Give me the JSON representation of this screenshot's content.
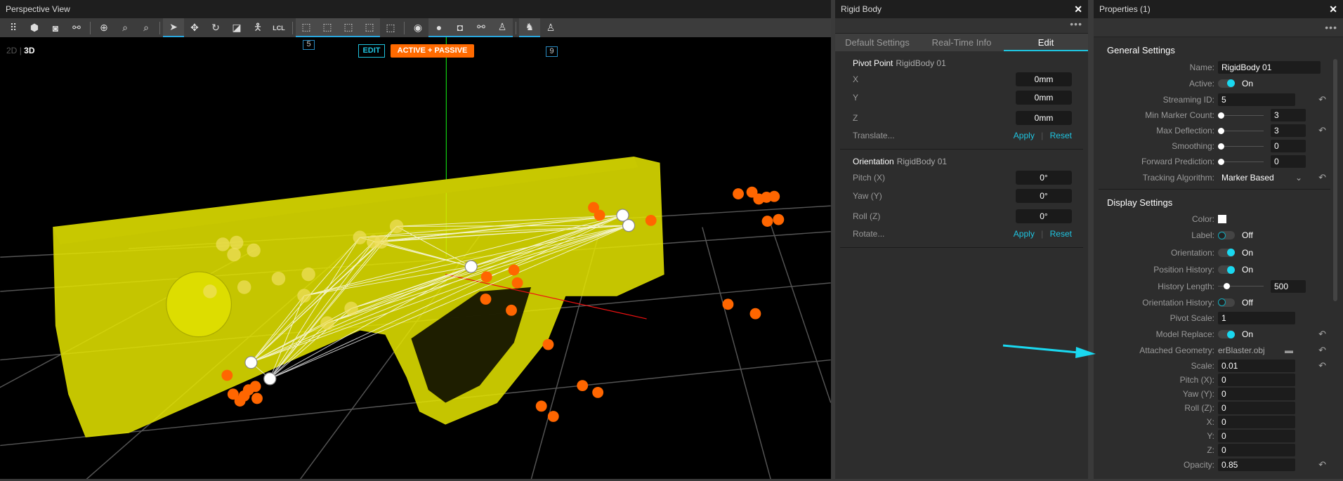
{
  "perspective": {
    "title": "Perspective View",
    "mode_2d": "2D",
    "mode_3d": "3D",
    "edit_badge": "EDIT",
    "mode_badge": "ACTIVE + PASSIVE",
    "marker_count_a": "5",
    "marker_count_b": "9",
    "toolbar_lcl": "LCL"
  },
  "rigid_body": {
    "title": "Rigid Body",
    "tabs": [
      "Default Settings",
      "Real-Time Info",
      "Edit"
    ],
    "pivot": {
      "heading": "Pivot Point",
      "name": "RigidBody 01",
      "rows": [
        {
          "label": "X",
          "value": "0mm"
        },
        {
          "label": "Y",
          "value": "0mm"
        },
        {
          "label": "Z",
          "value": "0mm"
        }
      ],
      "action": "Translate...",
      "apply": "Apply",
      "reset": "Reset"
    },
    "orientation": {
      "heading": "Orientation",
      "name": "RigidBody 01",
      "rows": [
        {
          "label": "Pitch (X)",
          "value": "0°"
        },
        {
          "label": "Yaw (Y)",
          "value": "0°"
        },
        {
          "label": "Roll (Z)",
          "value": "0°"
        }
      ],
      "action": "Rotate...",
      "apply": "Apply",
      "reset": "Reset"
    }
  },
  "properties": {
    "title": "Properties (1)",
    "general": {
      "heading": "General Settings",
      "name_label": "Name:",
      "name": "RigidBody 01",
      "active_label": "Active:",
      "active": "On",
      "streaming_label": "Streaming ID:",
      "streaming": "5",
      "min_label": "Min Marker Count:",
      "min": "3",
      "maxdef_label": "Max Deflection:",
      "maxdef": "3",
      "smooth_label": "Smoothing:",
      "smooth": "0",
      "fwd_label": "Forward Prediction:",
      "fwd": "0",
      "algo_label": "Tracking Algorithm:",
      "algo": "Marker Based"
    },
    "display": {
      "heading": "Display Settings",
      "color_label": "Color:",
      "color": "#ffffff",
      "label_label": "Label:",
      "label": "Off",
      "orient_label": "Orientation:",
      "orient": "On",
      "poshist_label": "Position History:",
      "poshist": "On",
      "histlen_label": "History Length:",
      "histlen": "500",
      "orhist_label": "Orientation History:",
      "orhist": "Off",
      "pivscale_label": "Pivot Scale:",
      "pivscale": "1",
      "model_label": "Model Replace:",
      "model": "On",
      "geom_label": "Attached Geometry:",
      "geom": "erBlaster.obj",
      "scale_label": "Scale:",
      "scale": "0.01",
      "pitch_label": "Pitch (X):",
      "pitch": "0",
      "yaw_label": "Yaw (Y):",
      "yaw": "0",
      "roll_label": "Roll (Z):",
      "roll": "0",
      "x_label": "X:",
      "x": "0",
      "y_label": "Y:",
      "y": "0",
      "z_label": "Z:",
      "z": "0",
      "opacity_label": "Opacity:",
      "opacity": "0.85"
    }
  },
  "colors": {
    "accent": "#1fc4e0",
    "mode_badge": "#ff6a00",
    "model": "#ffff00",
    "marker": "#ff6600"
  }
}
